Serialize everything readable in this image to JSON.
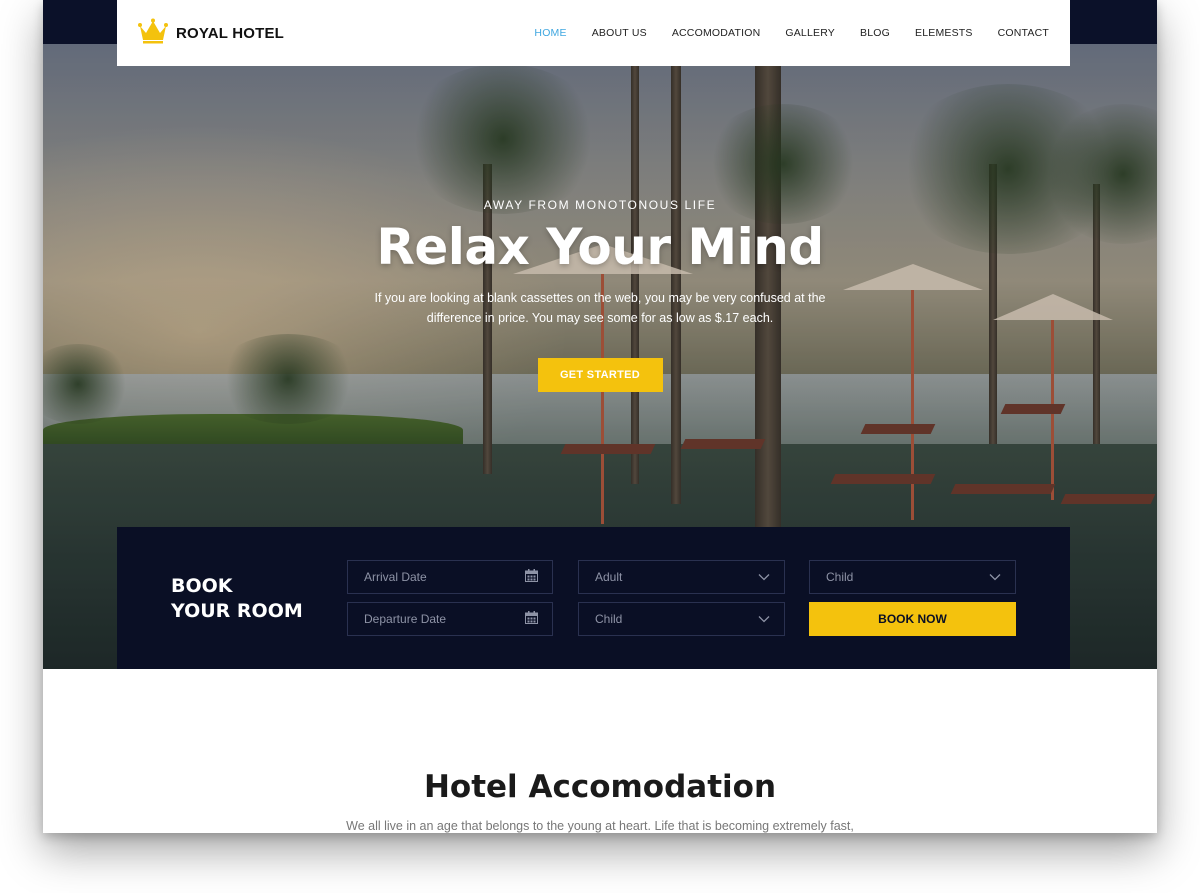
{
  "brand": {
    "name": "ROYAL HOTEL",
    "icon": "crown-icon",
    "icon_color": "#f4c20d"
  },
  "nav": {
    "items": [
      {
        "label": "HOME",
        "active": true
      },
      {
        "label": "ABOUT US",
        "active": false
      },
      {
        "label": "ACCOMODATION",
        "active": false
      },
      {
        "label": "GALLERY",
        "active": false
      },
      {
        "label": "BLOG",
        "active": false
      },
      {
        "label": "ELEMESTS",
        "active": false
      },
      {
        "label": "CONTACT",
        "active": false
      }
    ],
    "active_color": "#3fa7e0"
  },
  "hero": {
    "eyebrow": "AWAY FROM MONOTONOUS LIFE",
    "title": "Relax Your Mind",
    "description": "If you are looking at blank cassettes on the web, you may be very confused at the difference in price. You may see some for as low as $.17 each.",
    "cta_label": "GET STARTED",
    "accent_color": "#f4c20d"
  },
  "booking": {
    "title_line1": "BOOK",
    "title_line2": "YOUR ROOM",
    "arrival_placeholder": "Arrival Date",
    "departure_placeholder": "Departure Date",
    "adult_select": "Adult",
    "child_select_1": "Child",
    "child_select_2": "Child",
    "book_now_label": "BOOK NOW",
    "panel_color": "#0a0f25"
  },
  "section": {
    "title": "Hotel Accomodation",
    "subtitle": "We all live in an age that belongs to the young at heart. Life that is becoming extremely fast,"
  }
}
